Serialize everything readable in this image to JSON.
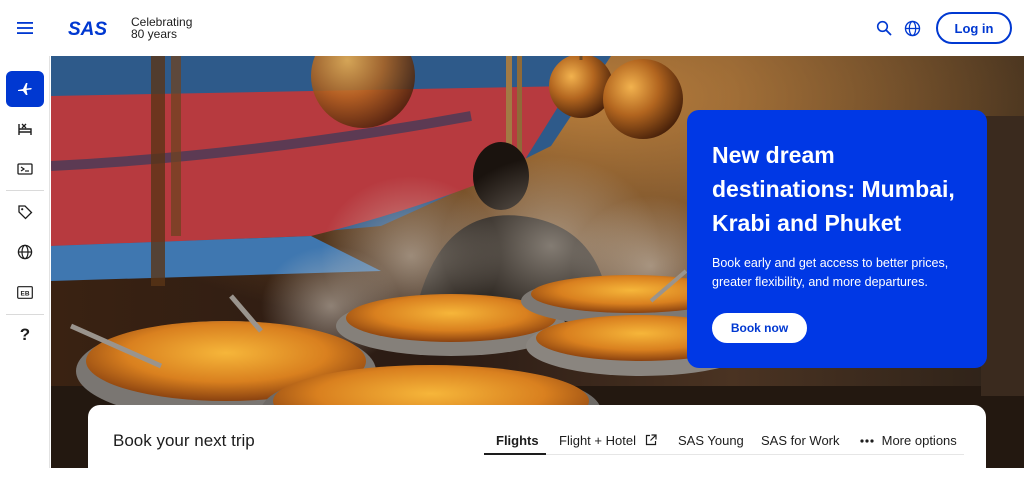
{
  "header": {
    "menu_icon": "hamburger-menu-icon",
    "logo_text": "SAS",
    "celebrating_line1": "Celebrating",
    "celebrating_line2": "80 years",
    "search_icon": "search-icon",
    "language_icon": "globe-icon",
    "login_label": "Log in",
    "brand_color": "#0038d1"
  },
  "sidebar": {
    "items": [
      {
        "icon": "airplane-icon",
        "active": true
      },
      {
        "icon": "hotel-bed-icon",
        "active": false
      },
      {
        "icon": "boarding-pass-icon",
        "active": false
      },
      {
        "icon": "tag-icon",
        "active": false
      },
      {
        "icon": "globe-icon",
        "active": false
      },
      {
        "icon": "eurobonus-card-icon",
        "label": "EB",
        "active": false
      },
      {
        "icon": "help-question-icon",
        "label": "?",
        "active": false
      }
    ]
  },
  "promo": {
    "heading": "New dream destinations: Mumbai, Krabi and Phuket",
    "body": "Book early and get access to better prices, greater flexibility, and more departures.",
    "cta_label": "Book now",
    "background_color": "#0038e5"
  },
  "booking": {
    "title": "Book your next trip",
    "tabs": [
      {
        "label": "Flights",
        "active": true
      },
      {
        "label": "Flight + Hotel",
        "icon": "external-link-icon"
      },
      {
        "label": "SAS Young"
      },
      {
        "label": "SAS for Work"
      },
      {
        "label": "More options",
        "icon": "more-dots-icon"
      }
    ]
  }
}
